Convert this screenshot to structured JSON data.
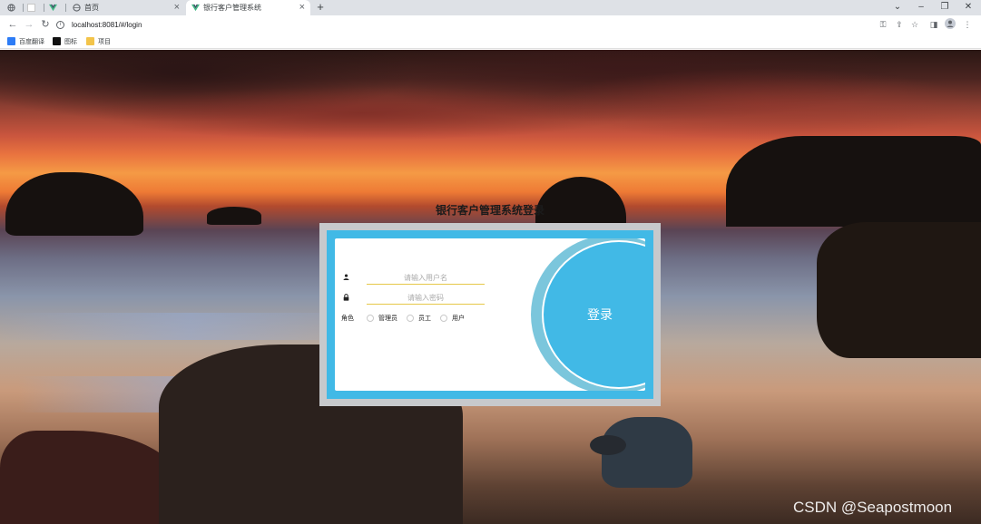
{
  "browser": {
    "tabs": [
      {
        "label": "首页"
      },
      {
        "label": "银行客户管理系统"
      }
    ],
    "address": "localhost:8081/#/login",
    "bookmarks": [
      {
        "label": "百度翻译",
        "color": "#2d7cf6"
      },
      {
        "label": "图标",
        "color": "#111111"
      },
      {
        "label": "项目",
        "color": "#f3c44a"
      }
    ]
  },
  "login": {
    "title": "银行客户管理系统登录",
    "username_placeholder": "请输入用户名",
    "password_placeholder": "请输入密码",
    "role_label": "角色",
    "roles": [
      "管理员",
      "员工",
      "用户"
    ],
    "submit_label": "登录"
  },
  "watermark": "CSDN @Seapostmoon",
  "colors": {
    "accent": "#41b9e6",
    "field_underline": "#e6c84a"
  }
}
